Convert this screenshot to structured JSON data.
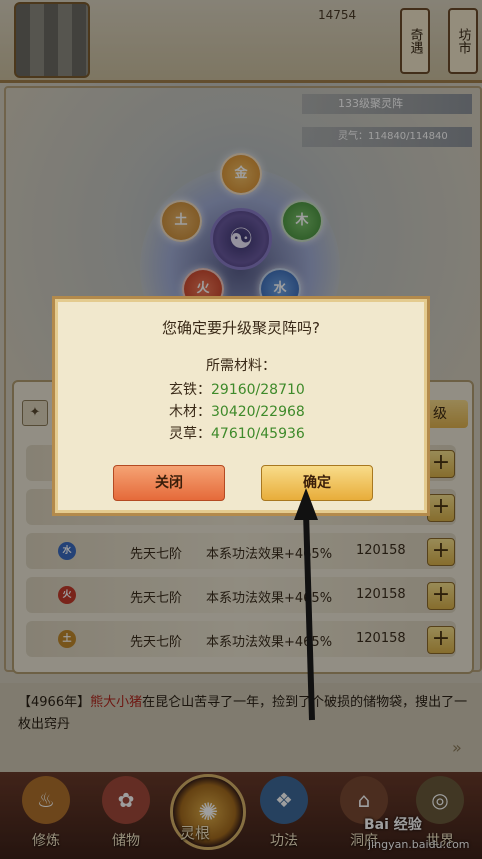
{
  "header": {
    "currency": "14754",
    "player_name": "",
    "qiyu_label": "奇遇",
    "fangshi_label": "坊市"
  },
  "array": {
    "level_label": "133级聚灵阵",
    "qi_label": "灵气：114840/114840",
    "center_glyph": "☯",
    "orbs": {
      "metal": "金",
      "earth": "土",
      "wood": "木",
      "fire": "火",
      "water": "水"
    }
  },
  "panel": {
    "icon_glyph": "✦",
    "level_chip": "级",
    "rows": [
      {
        "element": "水",
        "color": "#3a6bc0",
        "name": "先天七阶",
        "effect": "本系功法效果+465%",
        "cost": "120158",
        "plus": "+"
      },
      {
        "element": "火",
        "color": "#c43a2a",
        "name": "先天七阶",
        "effect": "本系功法效果+465%",
        "cost": "120158",
        "plus": "+"
      },
      {
        "element": "土",
        "color": "#c28a2c",
        "name": "先天七阶",
        "effect": "本系功法效果+465%",
        "cost": "120158",
        "plus": "+"
      }
    ],
    "hidden_plus": "+"
  },
  "log": {
    "year": "【4966年】",
    "who": "熊大小猪",
    "text": "在昆仑山苦寻了一年，捡到了个破损的储物袋，搜出了一枚出窍丹"
  },
  "nav": {
    "items": [
      "修炼",
      "储物",
      "灵根",
      "功法",
      "洞府",
      "世界"
    ],
    "center_glyph": "✺"
  },
  "watermark": {
    "brand": "Bai 经验",
    "url": "jingyan.baidu.com"
  },
  "dialog": {
    "title": "您确定要升级聚灵阵吗?",
    "requirements_label": "所需材料：",
    "materials": [
      {
        "name": "玄铁：",
        "value": "29160/28710"
      },
      {
        "name": "木材：",
        "value": "30420/22968"
      },
      {
        "name": "灵草：",
        "value": "47610/45936"
      }
    ],
    "close_label": "关闭",
    "confirm_label": "确定"
  }
}
